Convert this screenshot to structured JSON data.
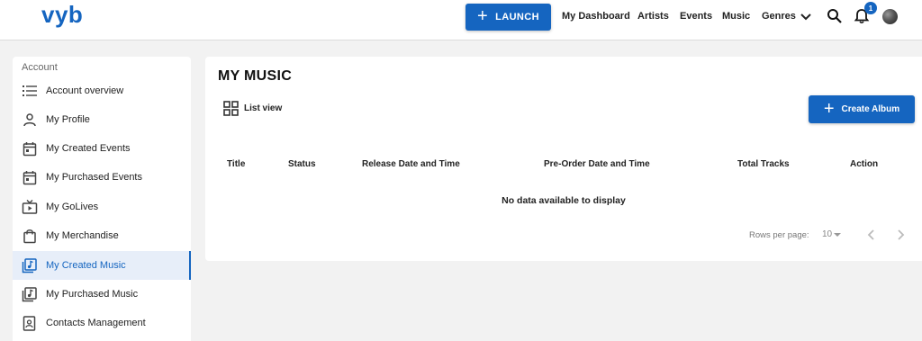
{
  "header": {
    "logo": "vyb",
    "launch_label": "LAUNCH",
    "nav": [
      "My Dashboard",
      "Artists",
      "Events",
      "Music",
      "Genres"
    ],
    "notification_count": "1"
  },
  "sidebar": {
    "heading": "Account",
    "items": [
      {
        "label": "Account overview",
        "icon": "list-icon"
      },
      {
        "label": "My Profile",
        "icon": "person-icon"
      },
      {
        "label": "My Created Events",
        "icon": "calendar-icon"
      },
      {
        "label": "My Purchased Events",
        "icon": "calendar-icon"
      },
      {
        "label": "My GoLives",
        "icon": "tv-icon"
      },
      {
        "label": "My Merchandise",
        "icon": "shopping-bag-icon"
      },
      {
        "label": "My Created Music",
        "icon": "music-library-icon",
        "active": true
      },
      {
        "label": "My Purchased Music",
        "icon": "music-library-icon"
      },
      {
        "label": "Contacts Management",
        "icon": "contact-card-icon"
      }
    ]
  },
  "main": {
    "title": "MY MUSIC",
    "list_view_label": "List view",
    "create_album_label": "Create Album",
    "columns": [
      "Title",
      "Status",
      "Release Date and Time",
      "Pre-Order Date and Time",
      "Total Tracks",
      "Action"
    ],
    "empty_message": "No data available to display",
    "rows_per_page_label": "Rows per page:",
    "rows_per_page_value": "10"
  },
  "colors": {
    "accent": "#1565c0",
    "background": "#f2f2f2",
    "active_item_bg": "#e7eef9"
  }
}
